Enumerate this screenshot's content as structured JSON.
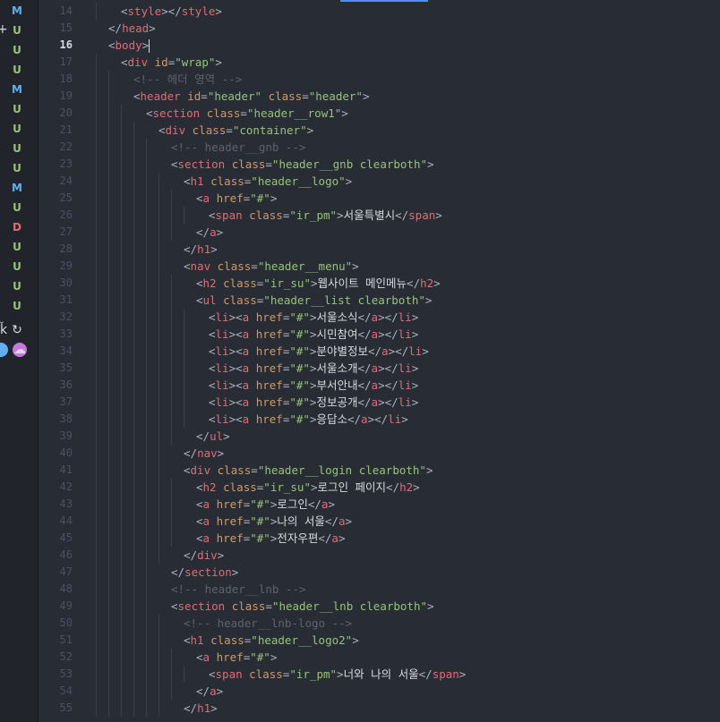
{
  "git_status": [
    "M",
    "U",
    "U",
    "U",
    "M",
    "U",
    "U",
    "U",
    "U",
    "M",
    "U",
    "D",
    "U",
    "U",
    "U",
    "U"
  ],
  "side_glyphs": {
    "plus": "+",
    "person": "ǩ",
    "refresh": "↻",
    "cloud": "☁"
  },
  "current_line": 16,
  "lines": [
    {
      "n": 14,
      "indent": 1,
      "tokens": [
        [
          "p",
          "<"
        ],
        [
          "t",
          "style"
        ],
        [
          "p",
          "></"
        ],
        [
          "t",
          "style"
        ],
        [
          "p",
          ">"
        ]
      ]
    },
    {
      "n": 15,
      "indent": 0,
      "tokens": [
        [
          "p",
          "</"
        ],
        [
          "t",
          "head"
        ],
        [
          "p",
          ">"
        ]
      ]
    },
    {
      "n": 16,
      "indent": 0,
      "tokens": [
        [
          "p",
          "<"
        ],
        [
          "t",
          "body"
        ],
        [
          "p",
          ">"
        ]
      ],
      "cursor": true
    },
    {
      "n": 17,
      "indent": 1,
      "tokens": [
        [
          "p",
          "<"
        ],
        [
          "t",
          "div"
        ],
        [
          "p",
          " "
        ],
        [
          "a",
          "id"
        ],
        [
          "p",
          "="
        ],
        [
          "s",
          "\"wrap\""
        ],
        [
          "p",
          ">"
        ]
      ]
    },
    {
      "n": 18,
      "indent": 2,
      "tokens": [
        [
          "c",
          "<!-- 헤더 영역 -->"
        ]
      ]
    },
    {
      "n": 19,
      "indent": 2,
      "tokens": [
        [
          "p",
          "<"
        ],
        [
          "t",
          "header"
        ],
        [
          "p",
          " "
        ],
        [
          "a",
          "id"
        ],
        [
          "p",
          "="
        ],
        [
          "s",
          "\"header\""
        ],
        [
          "p",
          " "
        ],
        [
          "a",
          "class"
        ],
        [
          "p",
          "="
        ],
        [
          "s",
          "\"header\""
        ],
        [
          "p",
          ">"
        ]
      ]
    },
    {
      "n": 20,
      "indent": 3,
      "tokens": [
        [
          "p",
          "<"
        ],
        [
          "t",
          "section"
        ],
        [
          "p",
          " "
        ],
        [
          "a",
          "class"
        ],
        [
          "p",
          "="
        ],
        [
          "s",
          "\"header__row1\""
        ],
        [
          "p",
          ">"
        ]
      ]
    },
    {
      "n": 21,
      "indent": 4,
      "tokens": [
        [
          "p",
          "<"
        ],
        [
          "t",
          "div"
        ],
        [
          "p",
          " "
        ],
        [
          "a",
          "class"
        ],
        [
          "p",
          "="
        ],
        [
          "s",
          "\"container\""
        ],
        [
          "p",
          ">"
        ]
      ]
    },
    {
      "n": 22,
      "indent": 5,
      "tokens": [
        [
          "c",
          "<!-- header__gnb -->"
        ]
      ]
    },
    {
      "n": 23,
      "indent": 5,
      "tokens": [
        [
          "p",
          "<"
        ],
        [
          "t",
          "section"
        ],
        [
          "p",
          " "
        ],
        [
          "a",
          "class"
        ],
        [
          "p",
          "="
        ],
        [
          "s",
          "\"header__gnb clearboth\""
        ],
        [
          "p",
          ">"
        ]
      ]
    },
    {
      "n": 24,
      "indent": 6,
      "tokens": [
        [
          "p",
          "<"
        ],
        [
          "t",
          "h1"
        ],
        [
          "p",
          " "
        ],
        [
          "a",
          "class"
        ],
        [
          "p",
          "="
        ],
        [
          "s",
          "\"header__logo\""
        ],
        [
          "p",
          ">"
        ]
      ]
    },
    {
      "n": 25,
      "indent": 7,
      "tokens": [
        [
          "p",
          "<"
        ],
        [
          "t",
          "a"
        ],
        [
          "p",
          " "
        ],
        [
          "a",
          "href"
        ],
        [
          "p",
          "="
        ],
        [
          "s",
          "\"#\""
        ],
        [
          "p",
          ">"
        ]
      ]
    },
    {
      "n": 26,
      "indent": 8,
      "tokens": [
        [
          "p",
          "<"
        ],
        [
          "t",
          "span"
        ],
        [
          "p",
          " "
        ],
        [
          "a",
          "class"
        ],
        [
          "p",
          "="
        ],
        [
          "s",
          "\"ir_pm\""
        ],
        [
          "p",
          ">"
        ],
        [
          "x",
          "서울특별시"
        ],
        [
          "p",
          "</"
        ],
        [
          "t",
          "span"
        ],
        [
          "p",
          ">"
        ]
      ]
    },
    {
      "n": 27,
      "indent": 7,
      "tokens": [
        [
          "p",
          "</"
        ],
        [
          "t",
          "a"
        ],
        [
          "p",
          ">"
        ]
      ]
    },
    {
      "n": 28,
      "indent": 6,
      "tokens": [
        [
          "p",
          "</"
        ],
        [
          "t",
          "h1"
        ],
        [
          "p",
          ">"
        ]
      ]
    },
    {
      "n": 29,
      "indent": 6,
      "tokens": [
        [
          "p",
          "<"
        ],
        [
          "t",
          "nav"
        ],
        [
          "p",
          " "
        ],
        [
          "a",
          "class"
        ],
        [
          "p",
          "="
        ],
        [
          "s",
          "\"header__menu\""
        ],
        [
          "p",
          ">"
        ]
      ]
    },
    {
      "n": 30,
      "indent": 7,
      "tokens": [
        [
          "p",
          "<"
        ],
        [
          "t",
          "h2"
        ],
        [
          "p",
          " "
        ],
        [
          "a",
          "class"
        ],
        [
          "p",
          "="
        ],
        [
          "s",
          "\"ir_su\""
        ],
        [
          "p",
          ">"
        ],
        [
          "x",
          "웹사이트 메인메뉴"
        ],
        [
          "p",
          "</"
        ],
        [
          "t",
          "h2"
        ],
        [
          "p",
          ">"
        ]
      ]
    },
    {
      "n": 31,
      "indent": 7,
      "tokens": [
        [
          "p",
          "<"
        ],
        [
          "t",
          "ul"
        ],
        [
          "p",
          " "
        ],
        [
          "a",
          "class"
        ],
        [
          "p",
          "="
        ],
        [
          "s",
          "\"header__list clearboth\""
        ],
        [
          "p",
          ">"
        ]
      ]
    },
    {
      "n": 32,
      "indent": 8,
      "tokens": [
        [
          "p",
          "<"
        ],
        [
          "t",
          "li"
        ],
        [
          "p",
          "><"
        ],
        [
          "t",
          "a"
        ],
        [
          "p",
          " "
        ],
        [
          "a",
          "href"
        ],
        [
          "p",
          "="
        ],
        [
          "s",
          "\"#\""
        ],
        [
          "p",
          ">"
        ],
        [
          "x",
          "서울소식"
        ],
        [
          "p",
          "</"
        ],
        [
          "t",
          "a"
        ],
        [
          "p",
          "></"
        ],
        [
          "t",
          "li"
        ],
        [
          "p",
          ">"
        ]
      ]
    },
    {
      "n": 33,
      "indent": 8,
      "tokens": [
        [
          "p",
          "<"
        ],
        [
          "t",
          "li"
        ],
        [
          "p",
          "><"
        ],
        [
          "t",
          "a"
        ],
        [
          "p",
          " "
        ],
        [
          "a",
          "href"
        ],
        [
          "p",
          "="
        ],
        [
          "s",
          "\"#\""
        ],
        [
          "p",
          ">"
        ],
        [
          "x",
          "시민참여"
        ],
        [
          "p",
          "</"
        ],
        [
          "t",
          "a"
        ],
        [
          "p",
          "></"
        ],
        [
          "t",
          "li"
        ],
        [
          "p",
          ">"
        ]
      ]
    },
    {
      "n": 34,
      "indent": 8,
      "tokens": [
        [
          "p",
          "<"
        ],
        [
          "t",
          "li"
        ],
        [
          "p",
          "><"
        ],
        [
          "t",
          "a"
        ],
        [
          "p",
          " "
        ],
        [
          "a",
          "href"
        ],
        [
          "p",
          "="
        ],
        [
          "s",
          "\"#\""
        ],
        [
          "p",
          ">"
        ],
        [
          "x",
          "분야별정보"
        ],
        [
          "p",
          "</"
        ],
        [
          "t",
          "a"
        ],
        [
          "p",
          "></"
        ],
        [
          "t",
          "li"
        ],
        [
          "p",
          ">"
        ]
      ]
    },
    {
      "n": 35,
      "indent": 8,
      "tokens": [
        [
          "p",
          "<"
        ],
        [
          "t",
          "li"
        ],
        [
          "p",
          "><"
        ],
        [
          "t",
          "a"
        ],
        [
          "p",
          " "
        ],
        [
          "a",
          "href"
        ],
        [
          "p",
          "="
        ],
        [
          "s",
          "\"#\""
        ],
        [
          "p",
          ">"
        ],
        [
          "x",
          "서울소개"
        ],
        [
          "p",
          "</"
        ],
        [
          "t",
          "a"
        ],
        [
          "p",
          "></"
        ],
        [
          "t",
          "li"
        ],
        [
          "p",
          ">"
        ]
      ]
    },
    {
      "n": 36,
      "indent": 8,
      "tokens": [
        [
          "p",
          "<"
        ],
        [
          "t",
          "li"
        ],
        [
          "p",
          "><"
        ],
        [
          "t",
          "a"
        ],
        [
          "p",
          " "
        ],
        [
          "a",
          "href"
        ],
        [
          "p",
          "="
        ],
        [
          "s",
          "\"#\""
        ],
        [
          "p",
          ">"
        ],
        [
          "x",
          "부서안내"
        ],
        [
          "p",
          "</"
        ],
        [
          "t",
          "a"
        ],
        [
          "p",
          "></"
        ],
        [
          "t",
          "li"
        ],
        [
          "p",
          ">"
        ]
      ]
    },
    {
      "n": 37,
      "indent": 8,
      "tokens": [
        [
          "p",
          "<"
        ],
        [
          "t",
          "li"
        ],
        [
          "p",
          "><"
        ],
        [
          "t",
          "a"
        ],
        [
          "p",
          " "
        ],
        [
          "a",
          "href"
        ],
        [
          "p",
          "="
        ],
        [
          "s",
          "\"#\""
        ],
        [
          "p",
          ">"
        ],
        [
          "x",
          "정보공개"
        ],
        [
          "p",
          "</"
        ],
        [
          "t",
          "a"
        ],
        [
          "p",
          "></"
        ],
        [
          "t",
          "li"
        ],
        [
          "p",
          ">"
        ]
      ]
    },
    {
      "n": 38,
      "indent": 8,
      "tokens": [
        [
          "p",
          "<"
        ],
        [
          "t",
          "li"
        ],
        [
          "p",
          "><"
        ],
        [
          "t",
          "a"
        ],
        [
          "p",
          " "
        ],
        [
          "a",
          "href"
        ],
        [
          "p",
          "="
        ],
        [
          "s",
          "\"#\""
        ],
        [
          "p",
          ">"
        ],
        [
          "x",
          "응답소"
        ],
        [
          "p",
          "</"
        ],
        [
          "t",
          "a"
        ],
        [
          "p",
          "></"
        ],
        [
          "t",
          "li"
        ],
        [
          "p",
          ">"
        ]
      ]
    },
    {
      "n": 39,
      "indent": 7,
      "tokens": [
        [
          "p",
          "</"
        ],
        [
          "t",
          "ul"
        ],
        [
          "p",
          ">"
        ]
      ]
    },
    {
      "n": 40,
      "indent": 6,
      "tokens": [
        [
          "p",
          "</"
        ],
        [
          "t",
          "nav"
        ],
        [
          "p",
          ">"
        ]
      ]
    },
    {
      "n": 41,
      "indent": 6,
      "tokens": [
        [
          "p",
          "<"
        ],
        [
          "t",
          "div"
        ],
        [
          "p",
          " "
        ],
        [
          "a",
          "class"
        ],
        [
          "p",
          "="
        ],
        [
          "s",
          "\"header__login clearboth\""
        ],
        [
          "p",
          ">"
        ]
      ]
    },
    {
      "n": 42,
      "indent": 7,
      "tokens": [
        [
          "p",
          "<"
        ],
        [
          "t",
          "h2"
        ],
        [
          "p",
          " "
        ],
        [
          "a",
          "class"
        ],
        [
          "p",
          "="
        ],
        [
          "s",
          "\"ir_su\""
        ],
        [
          "p",
          ">"
        ],
        [
          "x",
          "로그인 페이지"
        ],
        [
          "p",
          "</"
        ],
        [
          "t",
          "h2"
        ],
        [
          "p",
          ">"
        ]
      ]
    },
    {
      "n": 43,
      "indent": 7,
      "tokens": [
        [
          "p",
          "<"
        ],
        [
          "t",
          "a"
        ],
        [
          "p",
          " "
        ],
        [
          "a",
          "href"
        ],
        [
          "p",
          "="
        ],
        [
          "s",
          "\"#\""
        ],
        [
          "p",
          ">"
        ],
        [
          "x",
          "로그인"
        ],
        [
          "p",
          "</"
        ],
        [
          "t",
          "a"
        ],
        [
          "p",
          ">"
        ]
      ]
    },
    {
      "n": 44,
      "indent": 7,
      "tokens": [
        [
          "p",
          "<"
        ],
        [
          "t",
          "a"
        ],
        [
          "p",
          " "
        ],
        [
          "a",
          "href"
        ],
        [
          "p",
          "="
        ],
        [
          "s",
          "\"#\""
        ],
        [
          "p",
          ">"
        ],
        [
          "x",
          "나의 서울"
        ],
        [
          "p",
          "</"
        ],
        [
          "t",
          "a"
        ],
        [
          "p",
          ">"
        ]
      ]
    },
    {
      "n": 45,
      "indent": 7,
      "tokens": [
        [
          "p",
          "<"
        ],
        [
          "t",
          "a"
        ],
        [
          "p",
          " "
        ],
        [
          "a",
          "href"
        ],
        [
          "p",
          "="
        ],
        [
          "s",
          "\"#\""
        ],
        [
          "p",
          ">"
        ],
        [
          "x",
          "전자우편"
        ],
        [
          "p",
          "</"
        ],
        [
          "t",
          "a"
        ],
        [
          "p",
          ">"
        ]
      ]
    },
    {
      "n": 46,
      "indent": 6,
      "tokens": [
        [
          "p",
          "</"
        ],
        [
          "t",
          "div"
        ],
        [
          "p",
          ">"
        ]
      ]
    },
    {
      "n": 47,
      "indent": 5,
      "tokens": [
        [
          "p",
          "</"
        ],
        [
          "t",
          "section"
        ],
        [
          "p",
          ">"
        ]
      ]
    },
    {
      "n": 48,
      "indent": 5,
      "tokens": [
        [
          "c",
          "<!-- header__lnb -->"
        ]
      ]
    },
    {
      "n": 49,
      "indent": 5,
      "tokens": [
        [
          "p",
          "<"
        ],
        [
          "t",
          "section"
        ],
        [
          "p",
          " "
        ],
        [
          "a",
          "class"
        ],
        [
          "p",
          "="
        ],
        [
          "s",
          "\"header__lnb clearboth\""
        ],
        [
          "p",
          ">"
        ]
      ]
    },
    {
      "n": 50,
      "indent": 6,
      "tokens": [
        [
          "c",
          "<!-- header__lnb-logo -->"
        ]
      ]
    },
    {
      "n": 51,
      "indent": 6,
      "tokens": [
        [
          "p",
          "<"
        ],
        [
          "t",
          "h1"
        ],
        [
          "p",
          " "
        ],
        [
          "a",
          "class"
        ],
        [
          "p",
          "="
        ],
        [
          "s",
          "\"header__logo2\""
        ],
        [
          "p",
          ">"
        ]
      ]
    },
    {
      "n": 52,
      "indent": 7,
      "tokens": [
        [
          "p",
          "<"
        ],
        [
          "t",
          "a"
        ],
        [
          "p",
          " "
        ],
        [
          "a",
          "href"
        ],
        [
          "p",
          "="
        ],
        [
          "s",
          "\"#\""
        ],
        [
          "p",
          ">"
        ]
      ]
    },
    {
      "n": 53,
      "indent": 8,
      "tokens": [
        [
          "p",
          "<"
        ],
        [
          "t",
          "span"
        ],
        [
          "p",
          " "
        ],
        [
          "a",
          "class"
        ],
        [
          "p",
          "="
        ],
        [
          "s",
          "\"ir_pm\""
        ],
        [
          "p",
          ">"
        ],
        [
          "x",
          "너와 나의 서울"
        ],
        [
          "p",
          "</"
        ],
        [
          "t",
          "span"
        ],
        [
          "p",
          ">"
        ]
      ]
    },
    {
      "n": 54,
      "indent": 7,
      "tokens": [
        [
          "p",
          "</"
        ],
        [
          "t",
          "a"
        ],
        [
          "p",
          ">"
        ]
      ]
    },
    {
      "n": 55,
      "indent": 6,
      "tokens": [
        [
          "p",
          "</"
        ],
        [
          "t",
          "h1"
        ],
        [
          "p",
          ">"
        ]
      ]
    }
  ]
}
